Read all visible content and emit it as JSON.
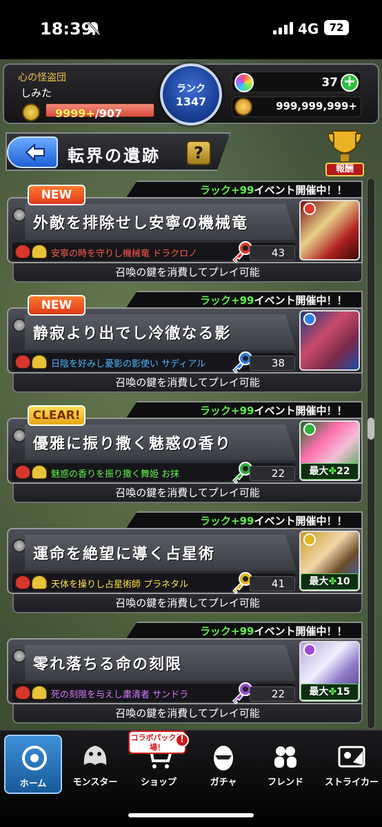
{
  "status_bar": {
    "time": "18:39",
    "network": "4G",
    "battery": "72",
    "icons": [
      "bell-muted-icon",
      "signal-icon"
    ]
  },
  "header": {
    "team_name": "心の怪盗団",
    "player_name": "しみた",
    "stamina_current": "9999+",
    "stamina_max": "/907",
    "rank_label": "ランク",
    "rank_value": "1347",
    "orbs": "37",
    "gold": "999,999,999+",
    "colors": {
      "stamina_bar": "#d84a3a",
      "rank_circle": "#163a8c",
      "orb_plus": "#2fbf3f"
    }
  },
  "title_bar": {
    "title": "転界の遺跡",
    "help_label": "?",
    "reward_label": "報酬"
  },
  "quests": [
    {
      "tag": "NEW",
      "banner_green": "ラック+99",
      "banner_white": "イベント開催中！！",
      "name": "外敵を排除せし安寧の機械竜",
      "monster": "安寧の時を守りし機械竜 ドラクロノ",
      "monster_color": "#ff5a4a",
      "element": "fire",
      "key_count": "43",
      "max_luck": null,
      "footer": "召喚の鍵を消費してプレイ可能"
    },
    {
      "tag": "NEW",
      "banner_green": "ラック+99",
      "banner_white": "イベント開催中！！",
      "name": "静寂より出でし冷徹なる影",
      "monster": "日陰を好みし憂影の影使い サディアル",
      "monster_color": "#4ab4ff",
      "element": "water",
      "key_count": "38",
      "max_luck": null,
      "footer": "召喚の鍵を消費してプレイ可能"
    },
    {
      "tag": "CLEAR!",
      "banner_green": "ラック+99",
      "banner_white": "イベント開催中！！",
      "name": "優雅に振り撒く魅惑の香り",
      "monster": "魅惑の香りを振り撒く舞姫 お抹",
      "monster_color": "#5ff04b",
      "element": "wood",
      "key_count": "22",
      "max_luck": "22",
      "footer": "召喚の鍵を消費してプレイ可能"
    },
    {
      "tag": null,
      "banner_green": "ラック+99",
      "banner_white": "イベント開催中！！",
      "name": "運命を絶望に導く占星術",
      "monster": "天体を操りし占星術師 プラネタル",
      "monster_color": "#ffe14a",
      "element": "light",
      "key_count": "41",
      "max_luck": "10",
      "footer": "召喚の鍵を消費してプレイ可能"
    },
    {
      "tag": null,
      "banner_green": "ラック+99",
      "banner_white": "イベント開催中！！",
      "name": "零れ落ちる命の刻限",
      "monster": "死の刻限を与えし粛清者 サンドラ",
      "monster_color": "#d878ff",
      "element": "dark",
      "key_count": "22",
      "max_luck": "15",
      "footer": "召喚の鍵を消費してプレイ可能"
    }
  ],
  "max_label": "最大",
  "bottom_nav": [
    {
      "label": "ホーム",
      "icon": "home-icon",
      "active": true
    },
    {
      "label": "モンスター",
      "icon": "monster-icon"
    },
    {
      "label": "ショップ",
      "icon": "shop-cart-icon"
    },
    {
      "label": "ガチャ",
      "icon": "gacha-egg-icon"
    },
    {
      "label": "フレンド",
      "icon": "friends-icon"
    },
    {
      "label": "ストライカー",
      "icon": "striker-icon"
    }
  ],
  "collab_badge": "コラボパック登場！",
  "collab_alert": "!"
}
